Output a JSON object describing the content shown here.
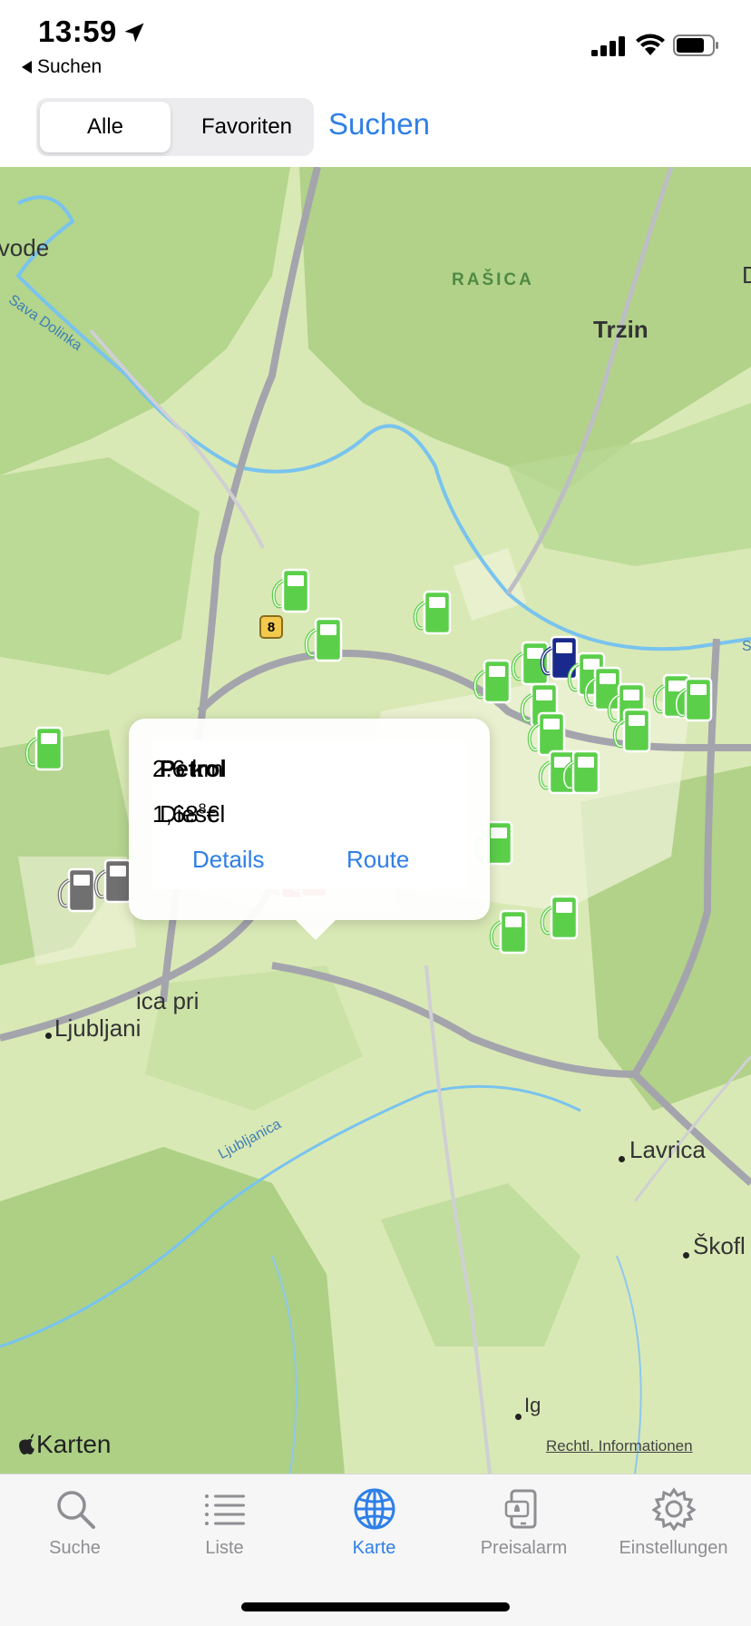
{
  "status_bar": {
    "time": "13:59",
    "back_label": "Suchen"
  },
  "header": {
    "segments": [
      {
        "label": "Alle",
        "selected": true
      },
      {
        "label": "Favoriten",
        "selected": false
      }
    ],
    "search_label": "Suchen"
  },
  "map": {
    "labels": {
      "vode": "lvode",
      "rasica": "RAŠICA",
      "trzin": "Trzin",
      "d_edge": "D",
      "medvode_river": "Sava Dolinka",
      "road8": "8",
      "ljubljanica_river": "Ljubljanica",
      "ica_pri": "ica pri",
      "ljubljani": "Ljubljani",
      "lavrica": "Lavrica",
      "skofl": "Škofl",
      "ig": "Ig",
      "s_edge": "S"
    },
    "attribution": "Karten",
    "legal": "Rechtl. Informationen",
    "colors": {
      "green_pump": "#5ccf4a",
      "blue_pump": "#1a2a8c",
      "red_pump": "#e03a3a",
      "gray_pump": "#707070"
    }
  },
  "callout": {
    "station": "Petrol",
    "distance": "2.6 km",
    "fuel": "Diesel",
    "price_main": "1,68",
    "price_sup": "8",
    "price_currency": "€",
    "details_label": "Details",
    "route_label": "Route"
  },
  "tabbar": {
    "tabs": [
      {
        "label": "Suche",
        "icon": "magnifier-icon"
      },
      {
        "label": "Liste",
        "icon": "list-icon"
      },
      {
        "label": "Karte",
        "icon": "globe-icon",
        "active": true
      },
      {
        "label": "Preisalarm",
        "icon": "phone-alarm-icon"
      },
      {
        "label": "Einstellungen",
        "icon": "gear-icon"
      }
    ]
  }
}
